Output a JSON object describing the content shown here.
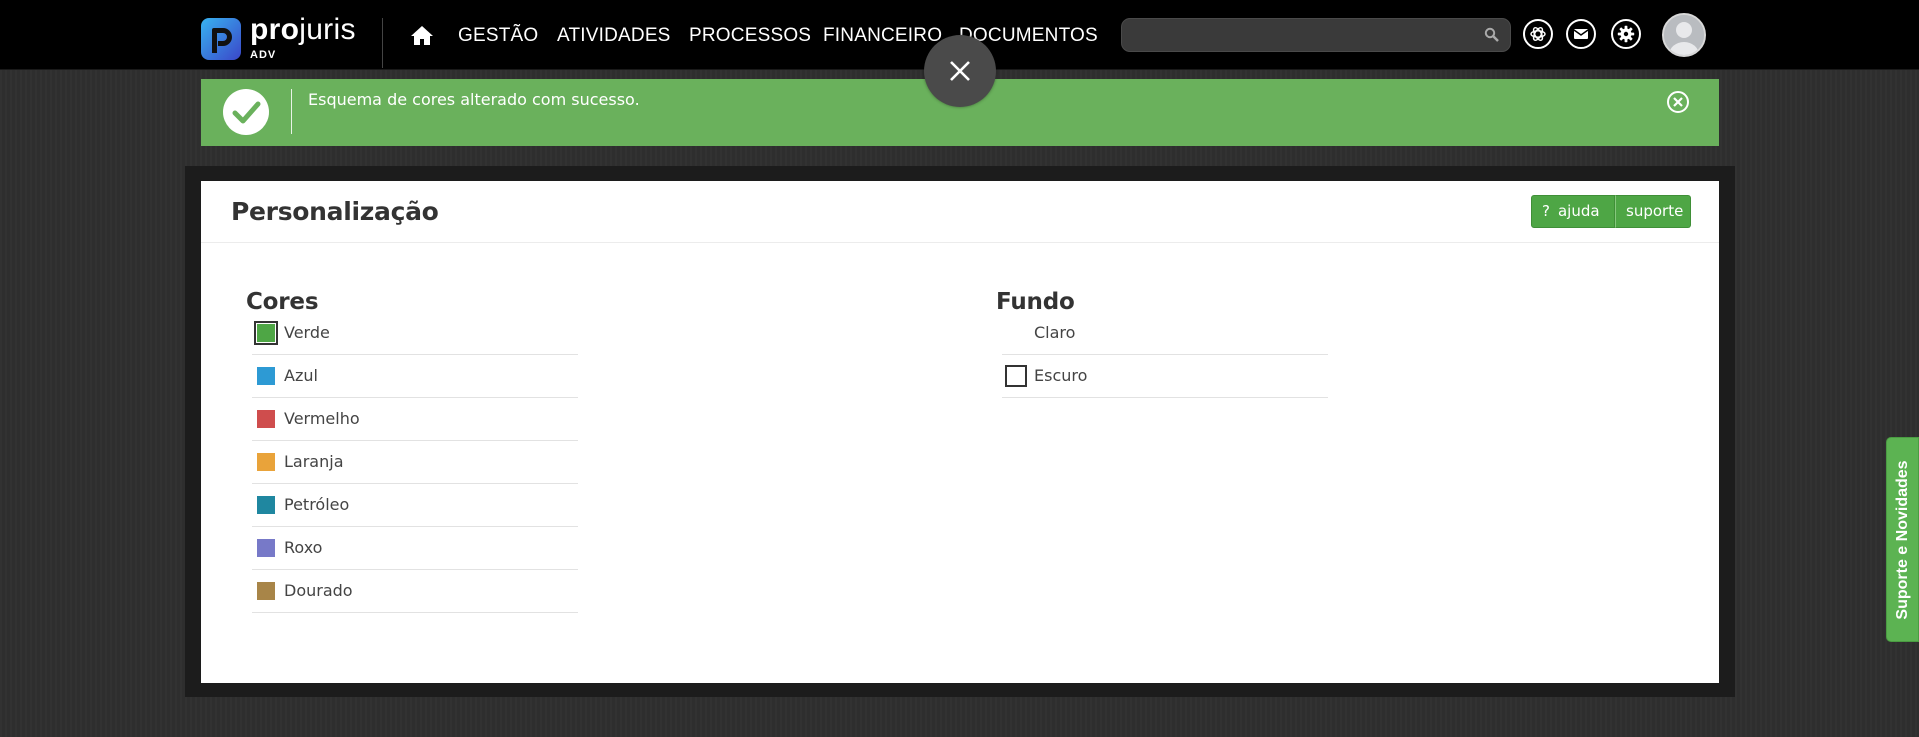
{
  "header": {
    "brand_bold": "pro",
    "brand_rest": "juris",
    "brand_sub": "ADV",
    "nav": [
      "GESTÃO",
      "ATIVIDADES",
      "PROCESSOS",
      "FINANCEIRO",
      "DOCUMENTOS"
    ],
    "search": {
      "placeholder": "",
      "value": ""
    }
  },
  "notification": {
    "message": "Esquema de cores alterado com sucesso."
  },
  "panel": {
    "title": "Personalização",
    "help_label": "ajuda",
    "help_icon": "?",
    "support_label": "suporte",
    "colors": {
      "title": "Cores",
      "selected": "Verde",
      "items": [
        {
          "label": "Verde",
          "color": "#4ea645"
        },
        {
          "label": "Azul",
          "color": "#2d9ad4"
        },
        {
          "label": "Vermelho",
          "color": "#cf4d4d"
        },
        {
          "label": "Laranja",
          "color": "#e9a33a"
        },
        {
          "label": "Petróleo",
          "color": "#1f87a0"
        },
        {
          "label": "Roxo",
          "color": "#7779c8"
        },
        {
          "label": "Dourado",
          "color": "#a88548"
        }
      ]
    },
    "background": {
      "title": "Fundo",
      "selected": "Escuro",
      "items": [
        {
          "label": "Claro"
        },
        {
          "label": "Escuro"
        }
      ]
    }
  },
  "side_tab": {
    "label": "Suporte e Novidades"
  },
  "colors": {
    "accent": "#4ea645",
    "notification": "#6ab15c",
    "topbar": "#000000"
  }
}
